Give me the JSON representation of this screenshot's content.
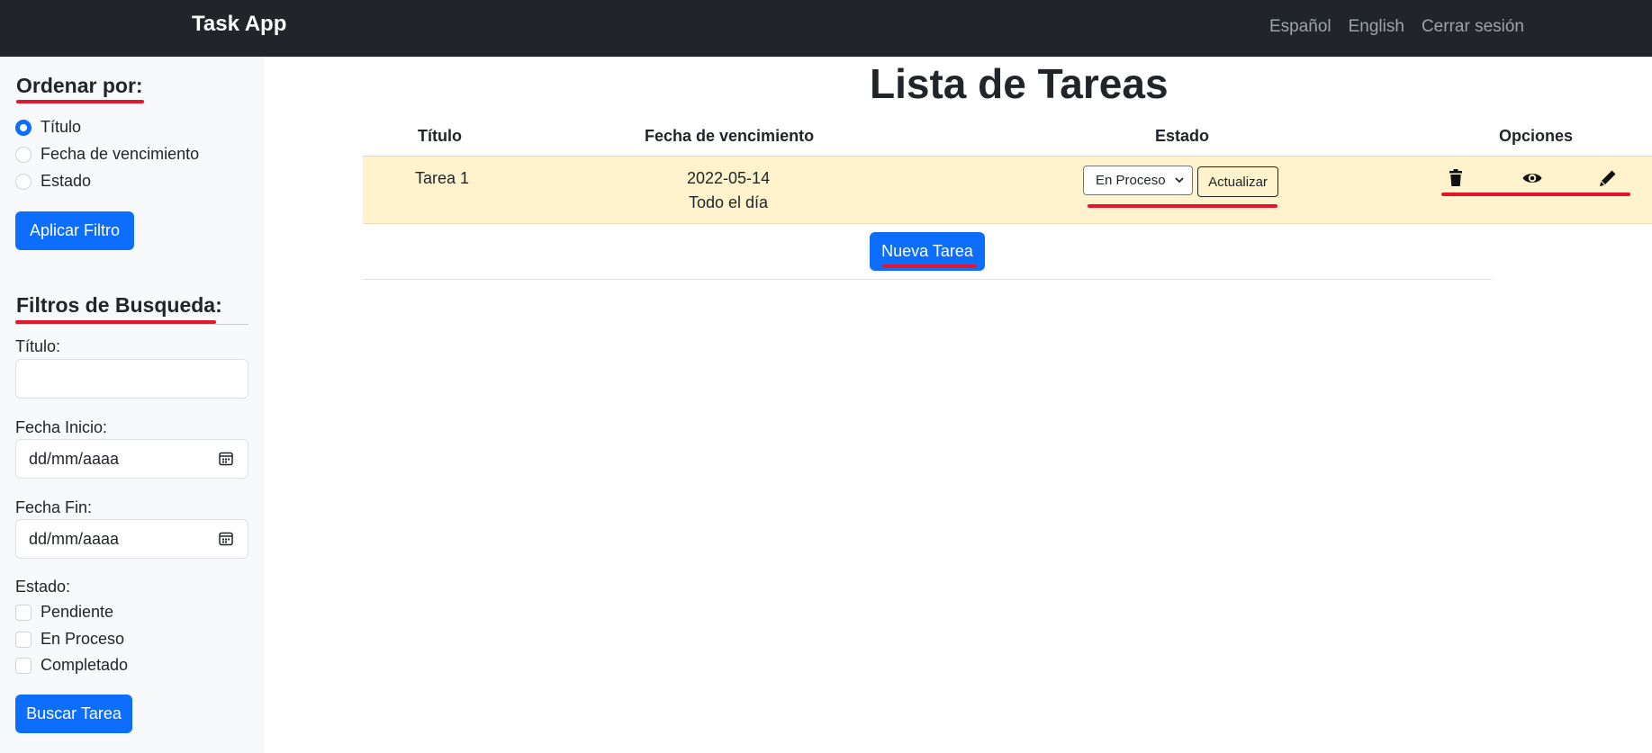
{
  "navbar": {
    "brand": "Task App",
    "links": [
      "Español",
      "English",
      "Cerrar sesión"
    ]
  },
  "sidebar": {
    "sort": {
      "heading": "Ordenar por:",
      "options": [
        {
          "label": "Título",
          "checked": true
        },
        {
          "label": "Fecha de vencimiento",
          "checked": false
        },
        {
          "label": "Estado",
          "checked": false
        }
      ],
      "apply_label": "Aplicar Filtro"
    },
    "filters": {
      "heading": "Filtros de Busqueda:",
      "title_label": "Título:",
      "title_value": "",
      "start_label": "Fecha Inicio:",
      "start_value": "dd/mm/aaaa",
      "end_label": "Fecha Fin:",
      "end_value": "dd/mm/aaaa",
      "state_label": "Estado:",
      "states": [
        {
          "label": "Pendiente",
          "checked": false
        },
        {
          "label": "En Proceso",
          "checked": false
        },
        {
          "label": "Completado",
          "checked": false
        }
      ],
      "search_label": "Buscar Tarea"
    }
  },
  "main": {
    "title": "Lista de Tareas",
    "columns": [
      "Título",
      "Fecha de vencimiento",
      "Estado",
      "Opciones"
    ],
    "tasks": [
      {
        "title": "Tarea 1",
        "due_date": "2022-05-14",
        "due_time": "Todo el día",
        "status": "En Proceso",
        "update_label": "Actualizar",
        "options": [
          "trash-icon",
          "eye-icon",
          "pencil-icon"
        ]
      }
    ],
    "new_task_label": "Nueva Tarea"
  },
  "colors": {
    "navbar_bg": "#212529",
    "primary": "#0d6efd",
    "row_highlight": "#fff3cd",
    "annotation": "#e8142b"
  }
}
